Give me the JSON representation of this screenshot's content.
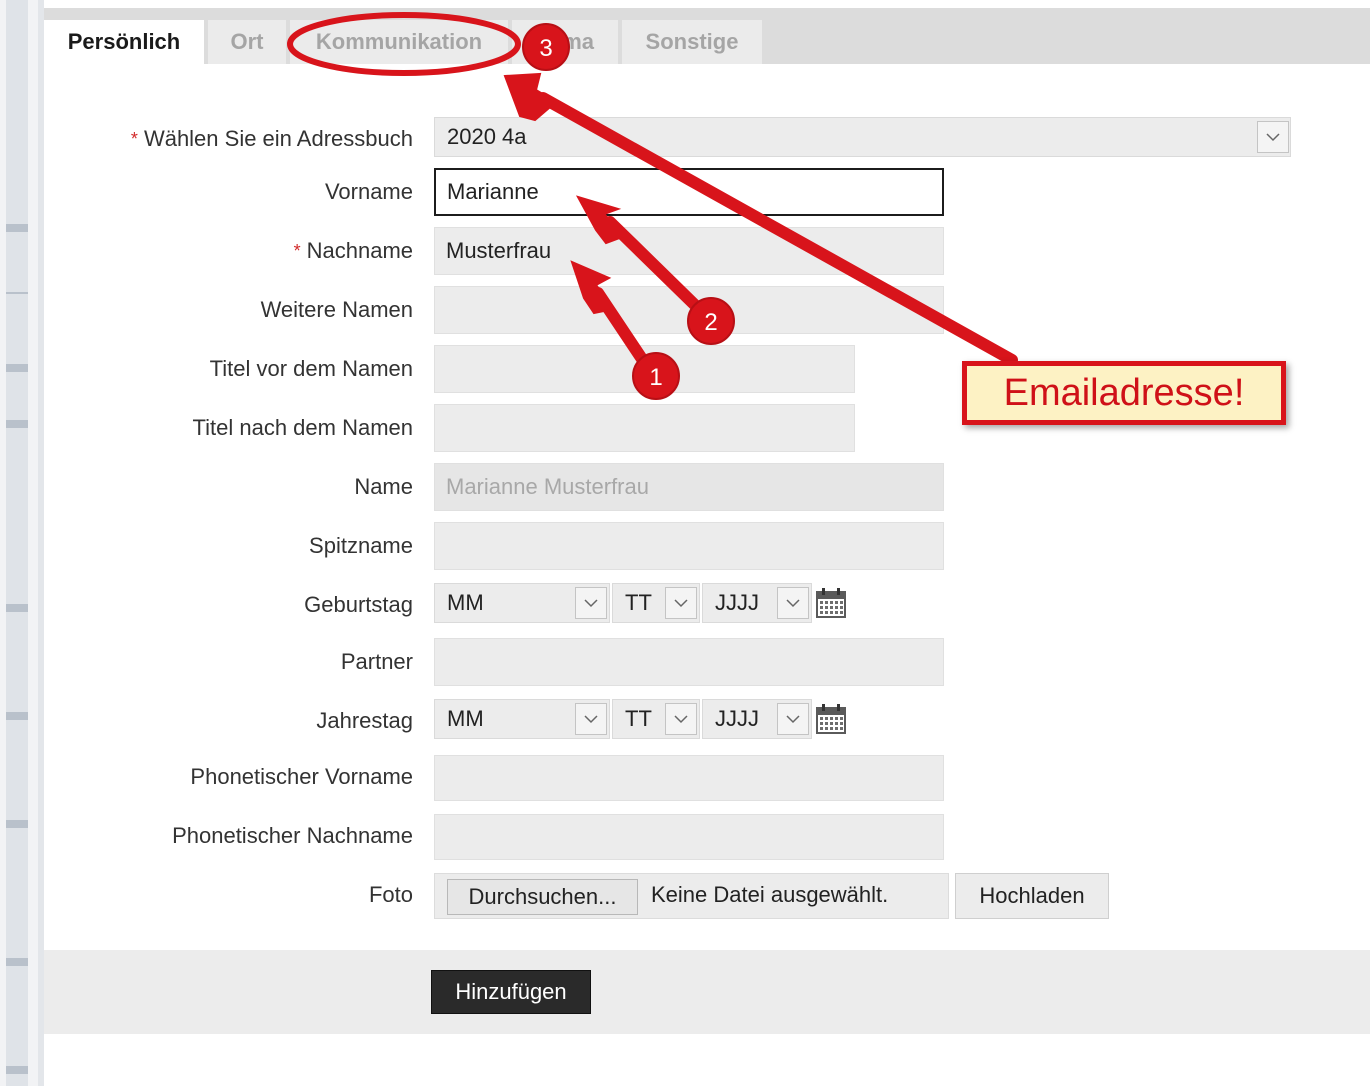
{
  "tabs": [
    {
      "label": "Persönlich",
      "active": true
    },
    {
      "label": "Ort",
      "active": false
    },
    {
      "label": "Kommunikation",
      "active": false
    },
    {
      "label": "ma",
      "active": false
    },
    {
      "label": "Sonstige",
      "active": false
    }
  ],
  "form": {
    "addressbook": {
      "label": "Wählen Sie ein Adressbuch",
      "required_mark": "*",
      "value": "2020 4a"
    },
    "vorname": {
      "label": "Vorname",
      "value": "Marianne"
    },
    "nachname": {
      "label": "Nachname",
      "required_mark": "*",
      "value": "Musterfrau"
    },
    "weitere_namen": {
      "label": "Weitere Namen",
      "value": ""
    },
    "titel_vor": {
      "label": "Titel vor dem Namen",
      "value": ""
    },
    "titel_nach": {
      "label": "Titel nach dem Namen",
      "value": ""
    },
    "name": {
      "label": "Name",
      "value": "Marianne Musterfrau"
    },
    "spitzname": {
      "label": "Spitzname",
      "value": ""
    },
    "geburtstag": {
      "label": "Geburtstag",
      "month": "MM",
      "day": "TT",
      "year": "JJJJ"
    },
    "partner": {
      "label": "Partner",
      "value": ""
    },
    "jahrestag": {
      "label": "Jahrestag",
      "month": "MM",
      "day": "TT",
      "year": "JJJJ"
    },
    "phon_vorname": {
      "label": "Phonetischer Vorname",
      "value": ""
    },
    "phon_nachname": {
      "label": "Phonetischer Nachname",
      "value": ""
    },
    "foto": {
      "label": "Foto",
      "browse": "Durchsuchen...",
      "no_file": "Keine Datei ausgewählt.",
      "upload": "Hochladen"
    }
  },
  "submit": {
    "label": "Hinzufügen"
  },
  "annotations": {
    "callout": "Emailadresse!",
    "badge_1": "1",
    "badge_2": "2",
    "badge_3": "3",
    "color": "#d8141b"
  },
  "icons": {
    "dropdown": "chevron-down-icon",
    "calendar": "calendar-icon"
  }
}
